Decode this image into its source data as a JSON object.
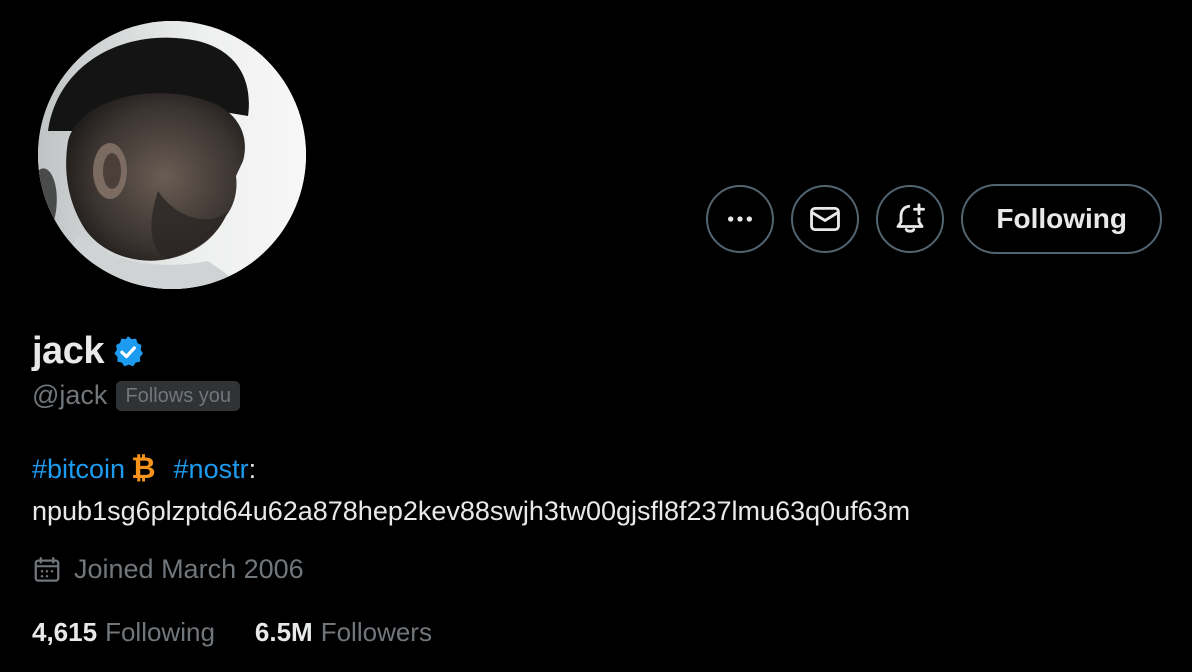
{
  "profile": {
    "display_name": "jack",
    "handle": "@jack",
    "follows_you_badge": "Follows you",
    "verified_icon": "verified-badge-icon",
    "verified_color": "#1d9bf0"
  },
  "actions": {
    "more_icon": "more-horizontal-icon",
    "message_icon": "envelope-icon",
    "notify_icon": "bell-plus-icon",
    "follow_label": "Following"
  },
  "bio": {
    "hashtag1": "#bitcoin",
    "bitcoin_symbol": "₿",
    "hashtag2": "#nostr",
    "colon": ":",
    "npub": "npub1sg6plzptd64u62a878hep2kev88swjh3tw00gjsfl8f237lmu63q0uf63m"
  },
  "meta": {
    "calendar_icon": "calendar-icon",
    "joined": "Joined March 2006"
  },
  "stats": {
    "following_count": "4,615",
    "following_label": "Following",
    "followers_count": "6.5M",
    "followers_label": "Followers"
  },
  "colors": {
    "background": "#000000",
    "text_primary": "#e7e9ea",
    "text_secondary": "#71767b",
    "accent": "#1d9bf0",
    "bitcoin": "#f7931a",
    "border": "#536471"
  }
}
